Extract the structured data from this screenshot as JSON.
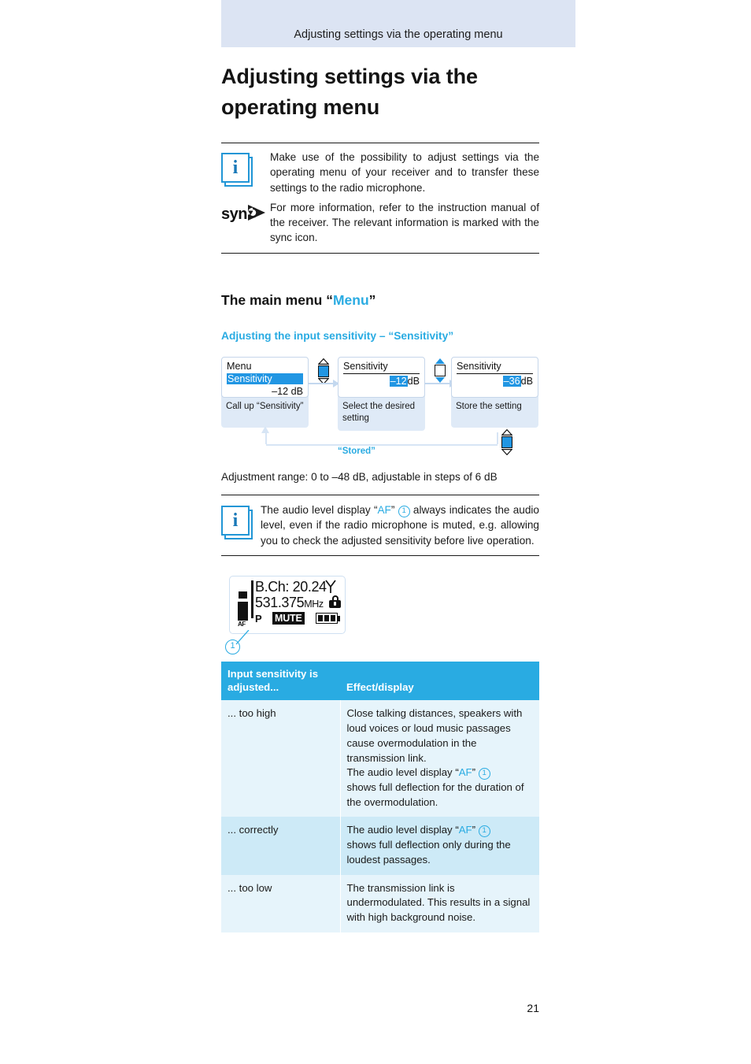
{
  "header": {
    "running_title": "Adjusting settings via the operating menu"
  },
  "title": "Adjusting settings via the operating menu",
  "note_box_1": {
    "rows": [
      {
        "icon": "info-icon",
        "text": "Make use of the possibility to adjust settings via the operating menu of your receiver and to transfer these settings to the radio microphone."
      },
      {
        "icon": "sync-icon",
        "icon_label": "syn",
        "text": "For more information, refer to the instruction manual of the receiver. The relevant information is marked with the sync icon."
      }
    ]
  },
  "section": {
    "h2_prefix": "The main menu “",
    "h2_accent": "Menu",
    "h2_suffix": "”",
    "h3": "Adjusting the input sensitivity – “Sensitivity”"
  },
  "diagram": {
    "steps": [
      {
        "display_title": "Menu",
        "display_selected": "Sensitivity",
        "display_value": "–12 dB",
        "caption": "Call up “Sensitivity”"
      },
      {
        "display_title": "Sensitivity",
        "value_highlight": "–12",
        "value_unit": "dB",
        "caption": "Select the desired setting"
      },
      {
        "display_title": "Sensitivity",
        "value_highlight": "–36",
        "value_unit": "dB",
        "caption": "Store the setting"
      }
    ],
    "buttons": [
      {
        "name": "set-button-filled",
        "style": "filled"
      },
      {
        "name": "up-down-button",
        "style": "open"
      },
      {
        "name": "set-button-filled-return",
        "style": "filled"
      }
    ],
    "return_label": "“Stored”"
  },
  "range_note": "Adjustment range: 0 to –48 dB, adjustable in steps of 6 dB",
  "note_box_2": {
    "icon": "info-icon",
    "text_before": "The audio level display “",
    "accent": "AF",
    "text_mid": "” ",
    "callout": "1",
    "text_after": " always indicates the audio level, even if the radio microphone is muted, e.g. allowing you to check the adjusted sensitivity before live operation."
  },
  "lcd_figure": {
    "line1": "B.Ch: 20.24",
    "line2_freq": "531.375",
    "line2_unit": "MHz",
    "af_label": "AF",
    "p_label": "P",
    "mute_label": "MUTE",
    "antenna_icon": "antenna-icon",
    "lock_icon": "lock-icon",
    "battery_icon": "battery-icon",
    "callout": "1"
  },
  "table": {
    "headers": [
      "Input sensitivity is adjusted...",
      "Effect/display"
    ],
    "rows": [
      {
        "condition": "... too high",
        "effect_before": "Close talking distances, speakers with loud voices or loud music passages cause overmodulation in the transmission link.\nThe audio level display “",
        "accent": "AF",
        "effect_mid": "” ",
        "callout": "1",
        "effect_after": "\nshows full deflection for the duration of the overmodulation."
      },
      {
        "condition": "... correctly",
        "effect_before": "The audio level display “",
        "accent": "AF",
        "effect_mid": "” ",
        "callout": "1",
        "effect_after": "\nshows full deflection only during the loudest passages."
      },
      {
        "condition": "... too low",
        "effect_before": "The transmission link is undermodulated. This results in a signal with high background noise.",
        "accent": "",
        "effect_mid": "",
        "callout": "",
        "effect_after": ""
      }
    ]
  },
  "page_number": "21",
  "colors": {
    "accent": "#29abe2",
    "header_band": "#dce4f3",
    "table_header": "#29abe2",
    "row_light": "#e6f4fb",
    "row_dark": "#cdeaf7",
    "caption_bg": "#dfeaf7"
  }
}
